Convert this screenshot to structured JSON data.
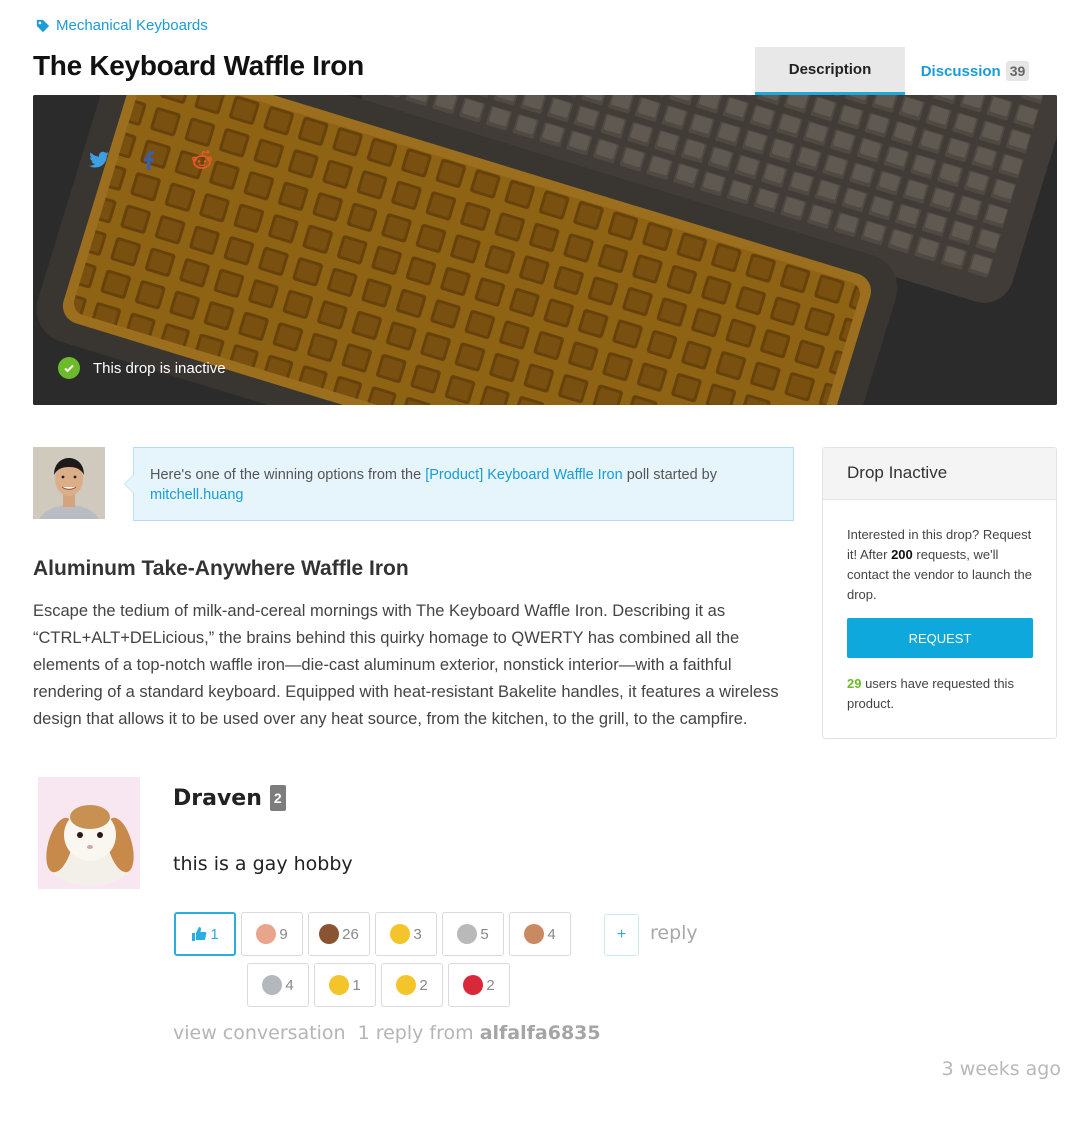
{
  "breadcrumb": {
    "category": "Mechanical Keyboards"
  },
  "product": {
    "title": "The Keyboard Waffle Iron"
  },
  "tabs": [
    {
      "label": "Description",
      "active": true
    },
    {
      "label": "Discussion",
      "count": "39",
      "active": false
    }
  ],
  "hero": {
    "share_icons": [
      "twitter-icon",
      "facebook-icon",
      "reddit-icon"
    ],
    "status_text": "This drop is inactive"
  },
  "poll": {
    "prefix": "Here's one of the winning options from the ",
    "link_text": "[Product] Keyboard Waffle Iron",
    "middle": " poll started by",
    "user": "mitchell.huang"
  },
  "option": {
    "heading": "Aluminum Take-Anywhere Waffle Iron",
    "body": "Escape the tedium of milk-and-cereal mornings with The Keyboard Waffle Iron. Describing it as “CTRL+ALT+DELicious,” the brains behind this quirky homage to QWERTY has combined all the elements of a top-notch waffle iron—die-cast aluminum exterior, nonstick interior—with a faithful rendering of a standard keyboard. Equipped with heat-resistant Bakelite handles, it features a wireless design that allows it to be used over any heat source, from the kitchen, to the grill, to the campfire."
  },
  "sidebar": {
    "header": "Drop Inactive",
    "text_before": "Interested in this drop? Request it! After ",
    "threshold": "200",
    "text_after": " requests, we'll contact the vendor to launch the drop.",
    "button_label": "REQUEST",
    "requested_count": "29",
    "requested_suffix": " users have requested this product."
  },
  "comment": {
    "author": "Draven",
    "badge": "2",
    "text": "this is a gay hobby",
    "likes": "1",
    "reactions_row1": [
      {
        "icon": "baby-icon",
        "count": "9",
        "color": "#e9a58c"
      },
      {
        "icon": "poop-icon",
        "count": "26",
        "color": "#8a5332"
      },
      {
        "icon": "smirk-icon",
        "count": "3",
        "color": "#f4c52b"
      },
      {
        "icon": "skull-icon",
        "count": "5",
        "color": "#b9b9b9"
      },
      {
        "icon": "clap-icon",
        "count": "4",
        "color": "#c98a63"
      }
    ],
    "reactions_row2": [
      {
        "icon": "alien-icon",
        "count": "4",
        "color": "#b3b8bd"
      },
      {
        "icon": "persevere-icon",
        "count": "1",
        "color": "#f4c52b"
      },
      {
        "icon": "fearful-icon",
        "count": "2",
        "color": "#f4c52b"
      },
      {
        "icon": "angry-icon",
        "count": "2",
        "color": "#d8283a"
      }
    ],
    "add_label": "+",
    "reply_label": "reply",
    "view_conversation": "view conversation",
    "reply_count_text": "1 reply from",
    "reply_user": "alfalfa6835",
    "timestamp": "3 weeks ago"
  }
}
